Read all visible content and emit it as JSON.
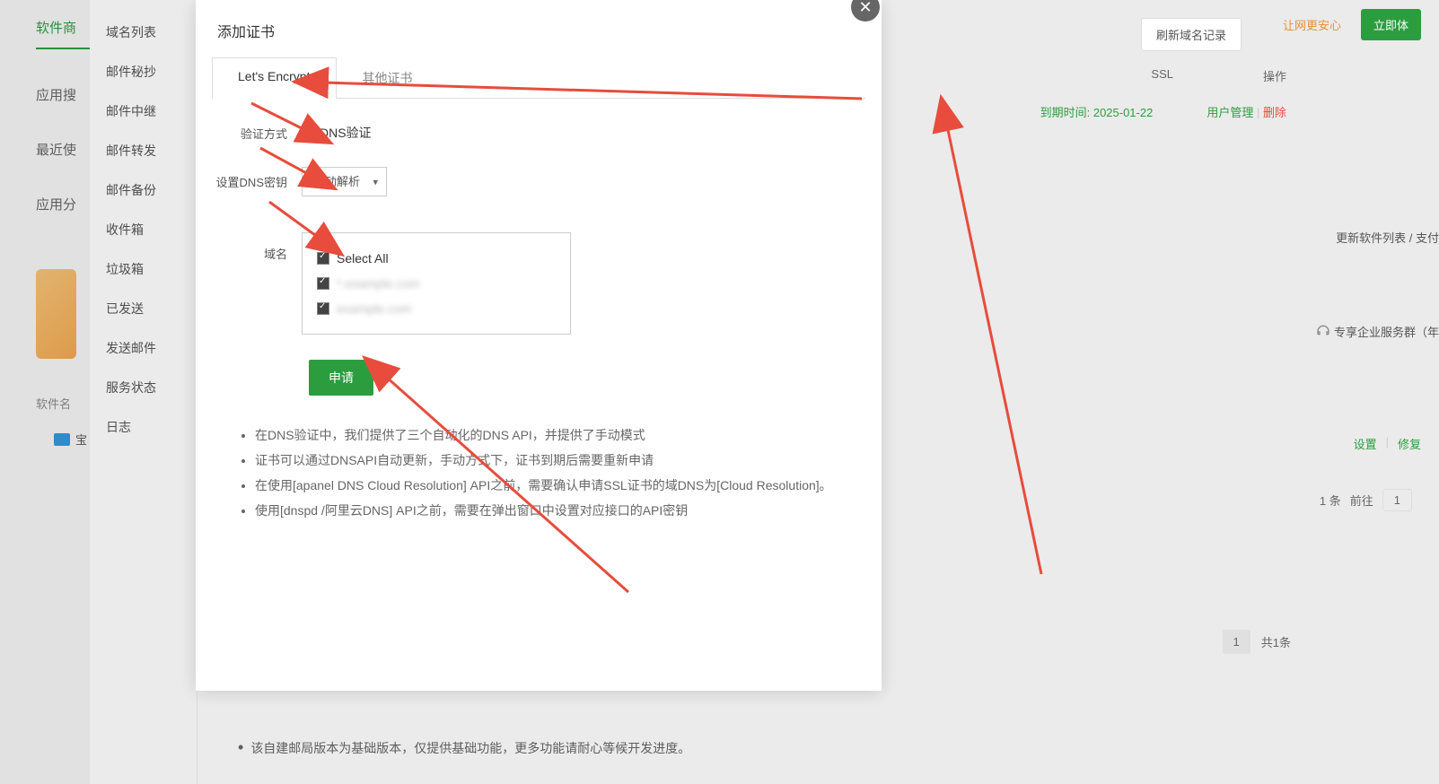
{
  "bg": {
    "left_nav": [
      "软件商",
      "应用搜",
      "最近使",
      "应用分"
    ],
    "sidebar": [
      "域名列表",
      "邮件秘抄",
      "邮件中继",
      "邮件转发",
      "邮件备份",
      "收件箱",
      "垃圾箱",
      "已发送",
      "发送邮件",
      "服务状态",
      "日志"
    ],
    "refresh": "刷新域名记录",
    "top_safe": "让网更安心",
    "top_cta": "立即体",
    "ssl_header": "SSL",
    "op_header": "操作",
    "expire": "到期时间: 2025-01-22",
    "user_mgmt": "用户管理",
    "delete": "删除",
    "update_list": "更新软件列表 / 支付",
    "service_group": "专享企业服务群（年",
    "settings": "设置",
    "restore": "修复",
    "pg_count": "1 条",
    "pg_goto": "前往",
    "pg_num": "1",
    "pagination_num": "1",
    "pagination_total": "共1条",
    "software_name": "软件名",
    "card_soft": "宝",
    "footer_note": "该自建邮局版本为基础版本，仅提供基础功能，更多功能请耐心等候开发进度。"
  },
  "modal": {
    "title": "添加证书",
    "tabs": {
      "lets_encrypt": "Let's Encrypt",
      "other": "其他证书"
    },
    "labels": {
      "verify": "验证方式",
      "dns_key": "设置DNS密钥",
      "domain": "域名"
    },
    "verify_option": "DNS验证",
    "dns_select": "手动解析",
    "select_all": "Select All",
    "domain1": "*.example.com",
    "domain2": "example.com",
    "submit": "申请",
    "notes": [
      "在DNS验证中，我们提供了三个自动化的DNS API，并提供了手动模式",
      "证书可以通过DNSAPI自动更新，手动方式下，证书到期后需要重新申请",
      "在使用[apanel DNS Cloud Resolution] API之前，需要确认申请SSL证书的域DNS为[Cloud Resolution]。",
      "使用[dnspd /阿里云DNS] API之前，需要在弹出窗口中设置对应接口的API密钥"
    ]
  }
}
